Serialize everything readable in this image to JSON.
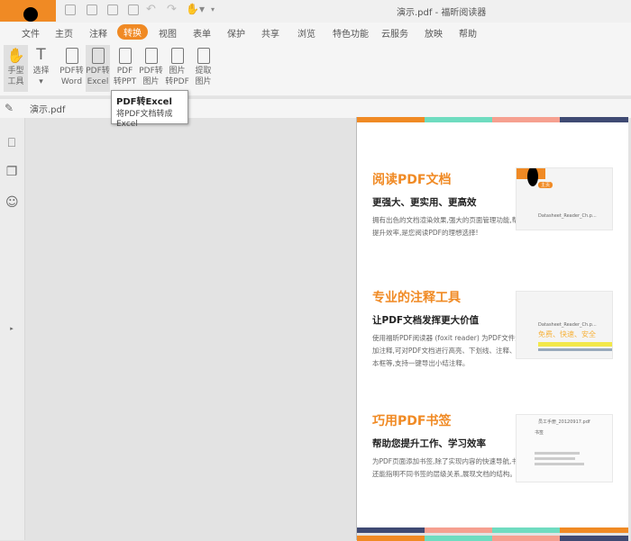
{
  "window": {
    "title": "演示.pdf - 福昕阅读器"
  },
  "menu": [
    "文件",
    "主页",
    "注释",
    "转换",
    "视图",
    "表单",
    "保护",
    "共享",
    "浏览",
    "特色功能",
    "云服务",
    "放映",
    "帮助"
  ],
  "active_menu": "转换",
  "ribbon": [
    {
      "l1": "手型",
      "l2": "工具"
    },
    {
      "l1": "选择",
      "l2": "▾"
    },
    {
      "l1": "PDF转",
      "l2": "Word"
    },
    {
      "l1": "PDF转",
      "l2": "Excel"
    },
    {
      "l1": "PDF",
      "l2": "转PPT"
    },
    {
      "l1": "PDF转",
      "l2": "图片"
    },
    {
      "l1": "图片",
      "l2": "转PDF"
    },
    {
      "l1": "提取",
      "l2": "图片"
    }
  ],
  "tooltip": {
    "title": "PDF转Excel",
    "desc": "将PDF文档转成Excel"
  },
  "doc_tab": "演示.pdf",
  "colors": {
    "orange": "#f08a24",
    "teal": "#6fdcc0",
    "salmon": "#f6a090",
    "navy": "#3f4a73"
  },
  "sections": [
    {
      "title": "阅读PDF文档",
      "subtitle": "更强大、更实用、更高效",
      "body": "拥有出色的文档渲染效果,强大的页面管理功能,帮助提升效率,是您阅读PDF的理想选择!",
      "shot": "Datasheet_Reader_Ch.p..."
    },
    {
      "title": "专业的注释工具",
      "subtitle": "让PDF文档发挥更大价值",
      "body": "使用福昕PDF阅读器 (foxit reader) 为PDF文件添加注释,可对PDF文档进行高亮、下划线、注释、文本框等,支持一键导出小结注释。",
      "shot": "Datasheet_Reader_Ch.p...",
      "shot_extra": "免费、快速、安全"
    },
    {
      "title": "巧用PDF书签",
      "subtitle": "帮助您提升工作、学习效率",
      "body": "为PDF页面添加书签,除了实现内容的快速导航,书签还能指明不同书签的层级关系,展现文档的结构。",
      "shot": "员工手册_20120917.pdf",
      "shot_extra": "书签"
    }
  ]
}
